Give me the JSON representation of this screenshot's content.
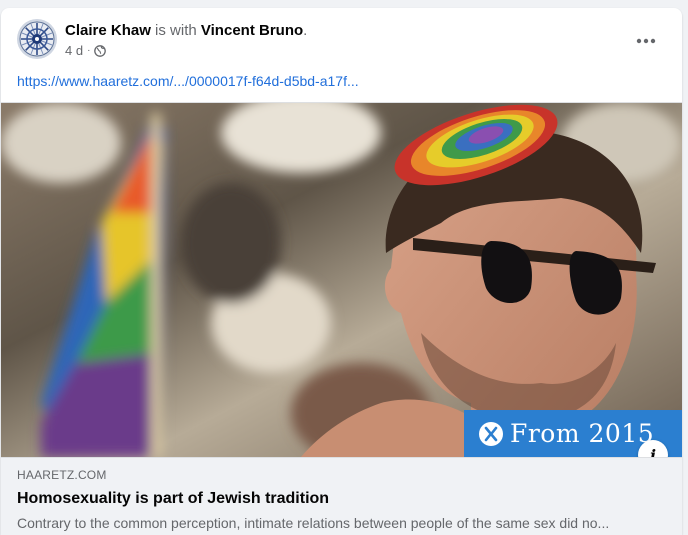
{
  "post": {
    "author": "Claire Khaw",
    "with_text": "is with",
    "tagged": "Vincent Bruno",
    "period": ".",
    "time": "4 d",
    "separator": "·",
    "audience_icon": "globe-icon",
    "more_icon": "more-options-icon",
    "link": "https://www.haaretz.com/.../0000017f-f64d-d5bd-a17f..."
  },
  "preview": {
    "badge_text": "From 2015",
    "badge_color": "#2b7fd0",
    "domain": "HAARETZ.COM",
    "headline": "Homosexuality is part of Jewish tradition",
    "description": "Contrary to the common perception, intimate relations between people of the same sex did no...",
    "info_label": "i"
  },
  "colors": {
    "link": "#216fdb",
    "secondary_text": "#65676b",
    "primary_text": "#050505",
    "preview_bg": "#f0f2f5"
  }
}
